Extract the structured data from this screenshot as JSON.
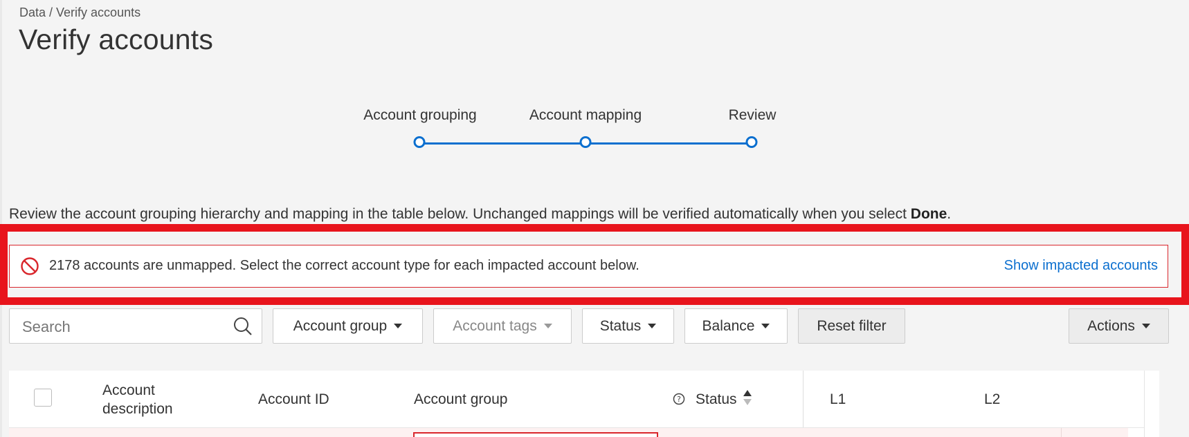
{
  "breadcrumb": "Data / Verify accounts",
  "page_title": "Verify accounts",
  "stepper": {
    "steps": [
      {
        "label": "Account grouping"
      },
      {
        "label": "Account mapping"
      },
      {
        "label": "Review"
      }
    ],
    "accent_color": "#0b6fcf"
  },
  "intro": {
    "text": "Review the account grouping hierarchy and mapping in the table below. Unchanged mappings will be verified automatically when you select ",
    "bold": "Done",
    "end": "."
  },
  "alert": {
    "icon": "blocked-icon",
    "message": "2178 accounts are unmapped. Select the correct account type for each impacted account below.",
    "link": "Show impacted accounts",
    "color": "#d9262c"
  },
  "toolbar": {
    "search_placeholder": "Search",
    "filters": [
      {
        "label": "Account group",
        "enabled": true
      },
      {
        "label": "Account tags",
        "enabled": false
      },
      {
        "label": "Status",
        "enabled": true
      },
      {
        "label": "Balance",
        "enabled": true
      }
    ],
    "reset_label": "Reset filter",
    "actions_label": "Actions"
  },
  "table": {
    "headers": {
      "description_line1": "Account",
      "description_line2": "description",
      "account_id": "Account ID",
      "account_group": "Account group",
      "status": "Status",
      "l1": "L1",
      "l2": "L2"
    }
  }
}
